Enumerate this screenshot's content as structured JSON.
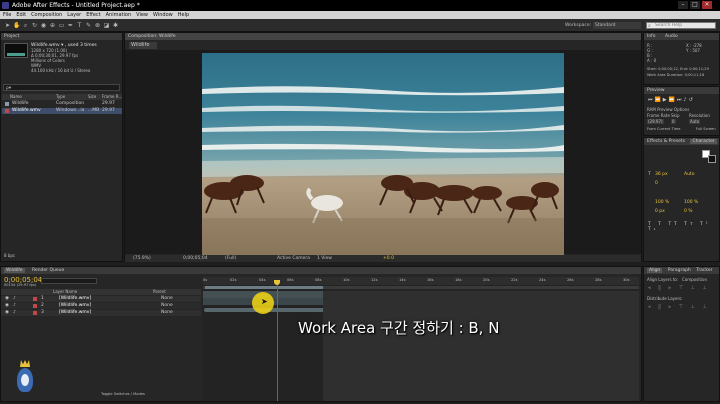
{
  "window": {
    "title": "Adobe After Effects - Untitled Project.aep *",
    "min": "–",
    "max": "□",
    "close": "✕"
  },
  "menu": [
    "File",
    "Edit",
    "Composition",
    "Layer",
    "Effect",
    "Animation",
    "View",
    "Window",
    "Help"
  ],
  "workspace": {
    "label": "Workspace:",
    "value": "Standard"
  },
  "search_help": {
    "placeholder": "Search Help"
  },
  "project": {
    "tab": "Project",
    "item_name": "Wildlife.wmv ▾ , used 3 times",
    "item_info": [
      "1280 x 720 (1.00)",
      "Δ 0;00;30;01, 29.97 fps",
      "Millions of Colors",
      "WMV",
      "44.100 kHz / 16 bit U / Stereo"
    ],
    "search_placeholder": "ρ▾",
    "columns": [
      "Name",
      "Type",
      "Size",
      "Frame R..."
    ],
    "items": [
      {
        "name": "Wildlife",
        "type": "Composition",
        "fps": "29.97"
      },
      {
        "name": "Wildlife.wmv",
        "type": "Windows...ia",
        "size": "...MB",
        "fps": "29.97"
      }
    ],
    "bpc": "8 bpc"
  },
  "composition": {
    "tab": "Composition: Wildlife",
    "tab_sub": "Wildlife",
    "zoom": "(75.9%)",
    "timecode": "0;00;05;04",
    "resolution": "(Full)",
    "camera": "Active Camera",
    "views": "1 View",
    "exposure": "+0.0"
  },
  "info": {
    "tab": "Info",
    "tab2": "Audio",
    "R": "R :",
    "G": "G :",
    "B": "B :",
    "A": "A : 0",
    "X": "X : -278",
    "Y": "Y : 507",
    "start": "Start: 0;00;00;12, End: 0;00;11;29",
    "work_area": "Work Area Duration: 0;00;11;18"
  },
  "preview": {
    "tab": "Preview",
    "ram_options": "RAM Preview Options",
    "labels": [
      "Frame Rate",
      "Skip",
      "Resolution"
    ],
    "values": [
      "(29.97)",
      "0",
      "Auto"
    ],
    "from_current": "From Current Time",
    "full_screen": "Full Screen"
  },
  "effects": {
    "tab": "Effects & Presets",
    "tab2": "Character"
  },
  "character": {
    "font_size": "36 px",
    "leading": "Auto",
    "tracking": "0",
    "scale_v": "100 %",
    "scale_h": "100 %",
    "baseline": "0 px",
    "tsume": "0 %",
    "units": "px"
  },
  "align": {
    "tab": "Align",
    "tab2": "Paragraph",
    "tab3": "Tracker",
    "align_to_label": "Align Layers to:",
    "align_to_value": "Composition",
    "distribute": "Distribute Layers:"
  },
  "timeline": {
    "tab": "Wildlife",
    "tab2": "Render Queue",
    "timecode": "0;00;05;04",
    "frames": "00154 (29.97 fps)",
    "columns": [
      "Layer Name",
      "Parent"
    ],
    "layers": [
      {
        "num": "1",
        "name": "[Wildlife.wmv]",
        "parent": "None"
      },
      {
        "num": "2",
        "name": "[Wildlife.wmv]",
        "parent": "None"
      },
      {
        "num": "3",
        "name": "[Wildlife.wmv]",
        "parent": "None"
      }
    ],
    "ruler": [
      "0s",
      "02s",
      "04s",
      "06s",
      "08s",
      "10s",
      "12s",
      "14s",
      "16s",
      "18s",
      "20s",
      "22s",
      "24s",
      "26s",
      "28s",
      "30s"
    ],
    "toggle": "Toggle Switches / Modes"
  },
  "caption": "Work Area 구간 정하기 : B, N",
  "colors": {
    "accent": "#f5b800",
    "playhead": "#d43b2a",
    "timecode": "#e8c23a",
    "work_area": "#6d7c85"
  },
  "icons": [
    "ae-logo-icon",
    "search-icon",
    "play-icon",
    "lock-icon",
    "eye-icon",
    "speaker-icon",
    "gear-icon",
    "cursor-highlight-icon",
    "mascot-icon"
  ]
}
